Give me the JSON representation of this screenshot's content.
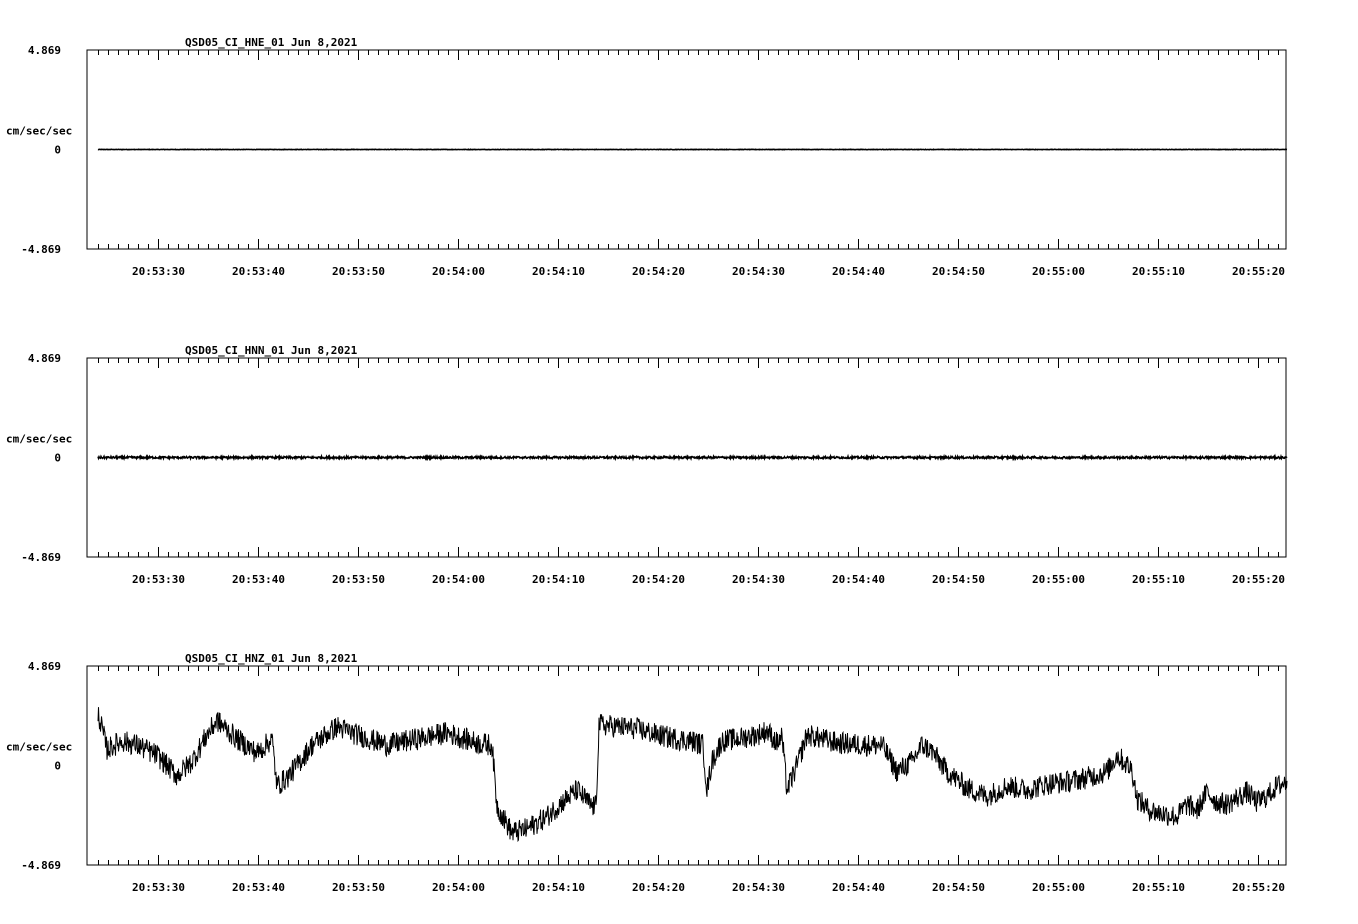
{
  "colors": {
    "background": "#ffffff",
    "ink": "#000000"
  },
  "chart_data": [
    {
      "type": "line",
      "title": "QSD05_CI_HNE_01  Jun 8,2021",
      "ylabel": "cm/sec/sec",
      "ylim": [
        -4.869,
        4.869
      ],
      "yticks": [
        "4.869",
        "0",
        "-4.869"
      ],
      "x_tick_labels": [
        "20:53:30",
        "20:53:40",
        "20:53:50",
        "20:54:00",
        "20:54:10",
        "20:54:20",
        "20:54:30",
        "20:54:40",
        "20:54:50",
        "20:55:00",
        "20:55:10",
        "20:55:20"
      ],
      "trace": {
        "start_s": 1.1,
        "end_s": 120.0,
        "baseline": 0.0,
        "noise_amplitude": 0.01
      }
    },
    {
      "type": "line",
      "title": "QSD05_CI_HNN_01  Jun 8,2021",
      "ylabel": "cm/sec/sec",
      "ylim": [
        -4.869,
        4.869
      ],
      "yticks": [
        "4.869",
        "0",
        "-4.869"
      ],
      "x_tick_labels": [
        "20:53:30",
        "20:53:40",
        "20:53:50",
        "20:54:00",
        "20:54:10",
        "20:54:20",
        "20:54:30",
        "20:54:40",
        "20:54:50",
        "20:55:00",
        "20:55:10",
        "20:55:20"
      ],
      "trace": {
        "start_s": 1.1,
        "end_s": 120.0,
        "baseline": 0.0,
        "noise_amplitude": 0.05
      }
    },
    {
      "type": "line",
      "title": "QSD05_CI_HNZ_01  Jun 8,2021",
      "ylabel": "cm/sec/sec",
      "ylim": [
        -4.869,
        4.869
      ],
      "yticks": [
        "4.869",
        "0",
        "-4.869"
      ],
      "x_tick_labels": [
        "20:53:30",
        "20:53:40",
        "20:53:50",
        "20:54:00",
        "20:54:10",
        "20:54:20",
        "20:54:30",
        "20:54:40",
        "20:54:50",
        "20:55:00",
        "20:55:10",
        "20:55:20"
      ],
      "trace": {
        "start_s": 1.1,
        "end_s": 120.0,
        "noise_amplitude": 0.55,
        "keypoints": [
          [
            1.1,
            2.6
          ],
          [
            2.0,
            0.8
          ],
          [
            3.5,
            1.2
          ],
          [
            5.0,
            1.0
          ],
          [
            7.0,
            0.5
          ],
          [
            9.0,
            -0.5
          ],
          [
            10.5,
            0.2
          ],
          [
            12.0,
            1.5
          ],
          [
            13.0,
            2.2
          ],
          [
            15.0,
            1.3
          ],
          [
            17.0,
            0.6
          ],
          [
            18.5,
            1.3
          ],
          [
            19.0,
            -1.0
          ],
          [
            20.0,
            -0.6
          ],
          [
            21.0,
            0.0
          ],
          [
            22.5,
            1.0
          ],
          [
            25.0,
            1.9
          ],
          [
            27.0,
            1.5
          ],
          [
            30.0,
            1.0
          ],
          [
            33.0,
            1.3
          ],
          [
            36.0,
            1.6
          ],
          [
            39.0,
            1.1
          ],
          [
            40.5,
            1.0
          ],
          [
            41.0,
            -2.0
          ],
          [
            42.5,
            -3.3
          ],
          [
            44.0,
            -3.1
          ],
          [
            46.0,
            -2.5
          ],
          [
            47.5,
            -1.8
          ],
          [
            49.0,
            -1.2
          ],
          [
            50.5,
            -2.0
          ],
          [
            50.9,
            -2.0
          ],
          [
            51.2,
            2.0
          ],
          [
            53.0,
            1.9
          ],
          [
            55.0,
            1.8
          ],
          [
            57.0,
            1.5
          ],
          [
            59.0,
            1.3
          ],
          [
            60.5,
            1.2
          ],
          [
            61.6,
            1.0
          ],
          [
            62.0,
            -1.2
          ],
          [
            62.5,
            0.2
          ],
          [
            63.5,
            1.2
          ],
          [
            65.0,
            1.3
          ],
          [
            67.0,
            1.5
          ],
          [
            68.0,
            1.7
          ],
          [
            69.0,
            1.1
          ],
          [
            69.5,
            1.4
          ],
          [
            70.0,
            -1.2
          ],
          [
            71.0,
            0.0
          ],
          [
            72.0,
            1.5
          ],
          [
            75.0,
            1.1
          ],
          [
            78.0,
            1.0
          ],
          [
            79.5,
            1.0
          ],
          [
            81.0,
            -0.3
          ],
          [
            82.5,
            0.2
          ],
          [
            83.5,
            1.0
          ],
          [
            84.5,
            0.7
          ],
          [
            86.0,
            -0.3
          ],
          [
            88.0,
            -1.1
          ],
          [
            90.0,
            -1.5
          ],
          [
            92.0,
            -1.0
          ],
          [
            94.0,
            -1.2
          ],
          [
            96.0,
            -0.9
          ],
          [
            98.0,
            -0.8
          ],
          [
            100.0,
            -0.6
          ],
          [
            102.0,
            -0.3
          ],
          [
            103.0,
            0.5
          ],
          [
            104.5,
            -0.2
          ],
          [
            105.0,
            -1.6
          ],
          [
            106.0,
            -2.1
          ],
          [
            107.0,
            -2.3
          ],
          [
            109.0,
            -2.5
          ],
          [
            110.0,
            -1.9
          ],
          [
            111.0,
            -2.2
          ],
          [
            112.0,
            -1.3
          ],
          [
            113.0,
            -1.8
          ],
          [
            114.0,
            -1.9
          ],
          [
            115.0,
            -1.6
          ],
          [
            116.0,
            -1.3
          ],
          [
            117.0,
            -1.8
          ],
          [
            118.0,
            -1.5
          ],
          [
            119.0,
            -1.0
          ],
          [
            120.0,
            -0.8
          ]
        ]
      }
    }
  ]
}
